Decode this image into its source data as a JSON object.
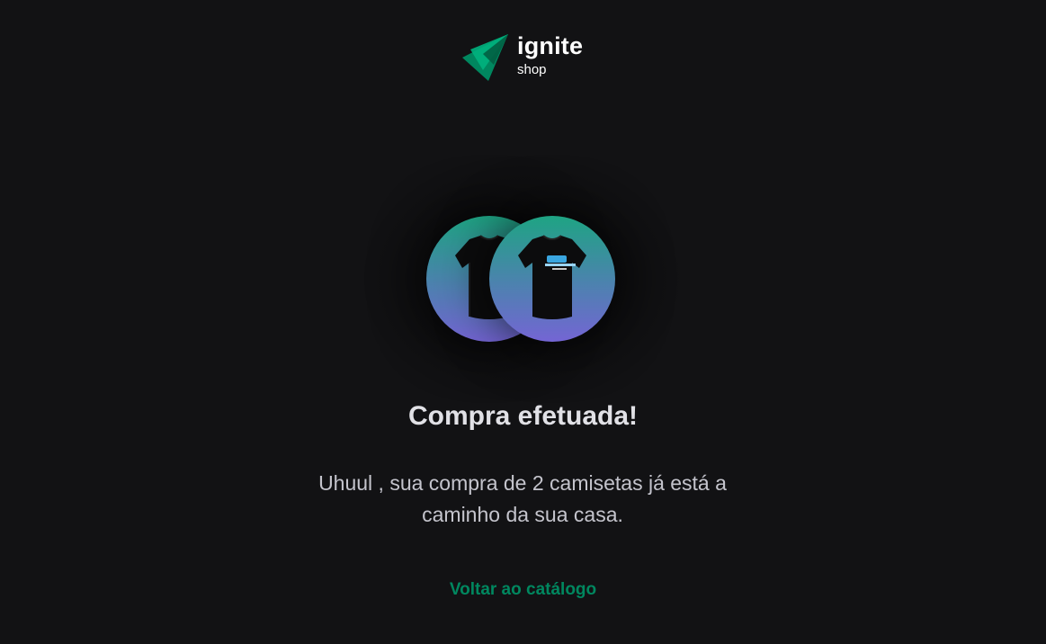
{
  "header": {
    "logo_title": "ignite",
    "logo_subtitle": "shop"
  },
  "products": [
    {
      "icon": "tshirt-image"
    },
    {
      "icon": "tshirt-image"
    }
  ],
  "success": {
    "title": "Compra efetuada!",
    "message": "Uhuul , sua compra de 2 camisetas já está a caminho da sua casa.",
    "back_link_label": "Voltar ao catálogo"
  },
  "colors": {
    "background": "#121214",
    "brand_green": "#00875f",
    "gradient_top": "#1ea483",
    "gradient_bottom": "#7465d4",
    "title": "#e1e1e6",
    "text": "#c4c4cc"
  }
}
